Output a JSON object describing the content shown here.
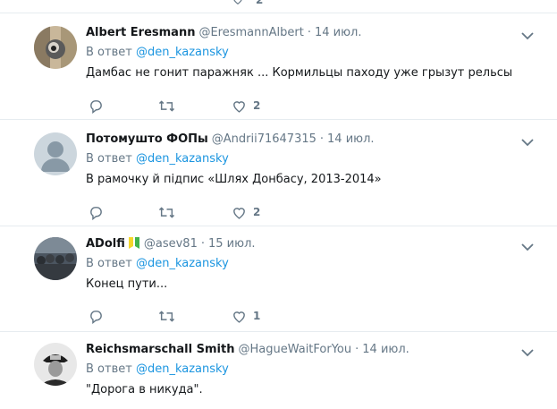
{
  "top_count": "2",
  "tweets": [
    {
      "name": "Albert Eresmann",
      "handle": "@EresmannAlbert",
      "dot": "·",
      "time": "14 июл.",
      "reply_prefix": "В ответ",
      "reply_to": "@den_kazansky",
      "text": "Дамбас не гонит паражняк ... Кормильцы паходу уже грызут рельсы",
      "likes": "2"
    },
    {
      "name": "Потомушто ФОПы",
      "handle": "@Andrii71647315",
      "dot": "·",
      "time": "14 июл.",
      "reply_prefix": "В ответ",
      "reply_to": "@den_kazansky",
      "text": "В рамочку й підпис «Шлях Донбасу, 2013-2014»",
      "likes": "2"
    },
    {
      "name": "ADolfi",
      "handle": "@asev81",
      "dot": "·",
      "time": "15 июл.",
      "reply_prefix": "В ответ",
      "reply_to": "@den_kazansky",
      "text": "Конец пути...",
      "likes": "1"
    },
    {
      "name": "Reichsmarschall Smith",
      "handle": "@HagueWaitForYou",
      "dot": "·",
      "time": "14 июл.",
      "reply_prefix": "В ответ",
      "reply_to": "@den_kazansky",
      "text": "\"Дорога в никуда\".",
      "likes": ""
    }
  ],
  "icons": {
    "reply": "reply-icon",
    "retweet": "retweet-icon",
    "like": "heart-icon",
    "caret": "chevron-down-icon",
    "badge": "green-yellow-badge-icon"
  },
  "colors": {
    "link": "#1b95e0",
    "muted": "#657786",
    "text": "#14171a",
    "border": "#e6ecf0"
  }
}
